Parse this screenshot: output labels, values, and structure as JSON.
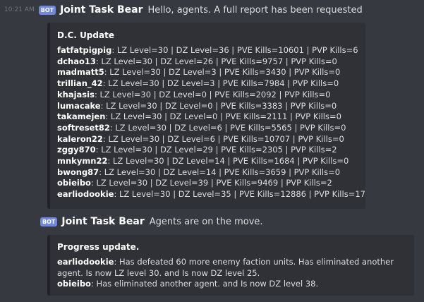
{
  "message1": {
    "timestamp": "10:21 AM",
    "badge": "BOT",
    "author": "Joint Task Bear",
    "content": "Hello, agents. A full report has been requested",
    "embed": {
      "title": "D.C. Update",
      "rows": [
        {
          "name": "fatfatpigpig",
          "text": ": LZ Level=30 | DZ Level=36 | PVE Kills=10601 | PVP Kills=6"
        },
        {
          "name": "dchao13",
          "text": ": LZ Level=30 | DZ Level=26 | PVE Kills=9757 | PVP Kills=0"
        },
        {
          "name": "madmatt5",
          "text": ": LZ Level=30 | DZ Level=3 | PVE Kills=3430 | PVP Kills=0"
        },
        {
          "name": "trillian_42",
          "text": ": LZ Level=30 | DZ Level=3 | PVE Kills=7984 | PVP Kills=0"
        },
        {
          "name": "khajasis",
          "text": ": LZ Level=30 | DZ Level=0 | PVE Kills=2092 | PVP Kills=0"
        },
        {
          "name": "lumacake",
          "text": ": LZ Level=30 | DZ Level=0 | PVE Kills=3383 | PVP Kills=0"
        },
        {
          "name": "takamejen",
          "text": ": LZ Level=30 | DZ Level=0 | PVE Kills=2111 | PVP Kills=0"
        },
        {
          "name": "softreset82",
          "text": ": LZ Level=30 | DZ Level=6 | PVE Kills=5565 | PVP Kills=0"
        },
        {
          "name": "kaleron22",
          "text": ": LZ Level=30 | DZ Level=6 | PVE Kills=10707 | PVP Kills=0"
        },
        {
          "name": "zggy870",
          "text": ": LZ Level=30 | DZ Level=29 | PVE Kills=2305 | PVP Kills=2"
        },
        {
          "name": "mnkymn22",
          "text": ": LZ Level=30 | DZ Level=14 | PVE Kills=1684 | PVP Kills=0"
        },
        {
          "name": "bwong87",
          "text": ": LZ Level=30 | DZ Level=14 | PVE Kills=3659 | PVP Kills=0"
        },
        {
          "name": "obieibo",
          "text": ": LZ Level=30 | DZ Level=39 | PVE Kills=9469 | PVP Kills=2"
        },
        {
          "name": "earliodookie",
          "text": ": LZ Level=30 | DZ Level=35 | PVE Kills=12886 | PVP Kills=17"
        }
      ]
    }
  },
  "message2": {
    "badge": "BOT",
    "author": "Joint Task Bear",
    "content": "Agents are on the move.",
    "embed": {
      "title": "Progress update.",
      "rows": [
        {
          "name": "earliodookie",
          "line1": ": Has defeated 60 more enemy faction units. Has eliminated another",
          "line2": "agent. Is now LZ level 30. and Is now DZ level 25."
        },
        {
          "name": "obieibo",
          "line1": ": Has eliminated another agent. and Is now DZ level 38.",
          "line2": ""
        }
      ]
    }
  }
}
